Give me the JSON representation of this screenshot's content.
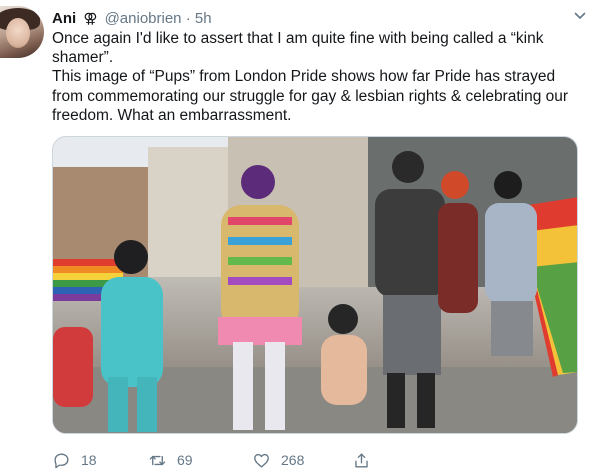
{
  "tweet": {
    "author_name": "Ani",
    "author_symbol": "⚢",
    "handle": "@aniobrien",
    "separator": "·",
    "timestamp": "5h",
    "paragraph_1": "Once again I'd like to assert that I am quite fine with being called a “kink shamer”.",
    "paragraph_2": "This image of “Pups” from London Pride shows how far Pride has strayed from commemorating our struggle for gay & lesbian rights & celebrating our freedom. What an embarrassment."
  },
  "actions": {
    "replies": "18",
    "retweets": "69",
    "likes": "268"
  },
  "icons": {
    "reply": "reply-icon",
    "retweet": "retweet-icon",
    "like": "heart-icon",
    "share": "share-icon",
    "menu": "chevron-down-icon"
  },
  "colors": {
    "text": "#14171a",
    "muted": "#657786",
    "border": "#ccd6dd"
  }
}
